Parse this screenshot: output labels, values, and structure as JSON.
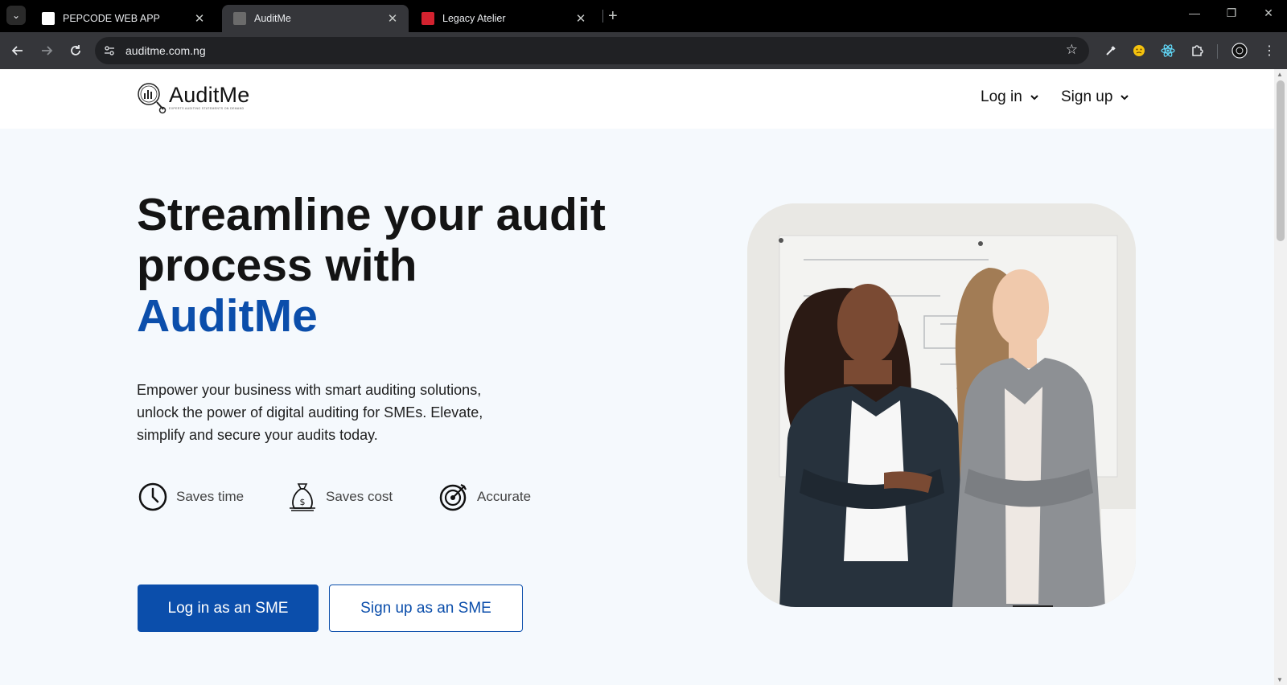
{
  "browser": {
    "tabs": [
      {
        "title": "PEPCODE WEB APP",
        "active": false,
        "favicon": "white-square"
      },
      {
        "title": "AuditMe",
        "active": true,
        "favicon": "auditme-gray"
      },
      {
        "title": "Legacy Atelier",
        "active": false,
        "favicon": "red-badge"
      }
    ],
    "url": "auditme.com.ng"
  },
  "site": {
    "logo": {
      "name": "AuditMe",
      "tagline": "EXPERTS AUDITING STATEMENTS ON DEMAND"
    },
    "nav": {
      "login_label": "Log in",
      "signup_label": "Sign up"
    },
    "hero": {
      "title_line1": "Streamline your audit",
      "title_line2": "process with",
      "title_accent": "AuditMe",
      "description": "Empower your business with smart auditing solutions, unlock the power of digital auditing for SMEs. Elevate, simplify and secure your audits today.",
      "features": [
        {
          "label": "Saves time",
          "icon": "clock-icon"
        },
        {
          "label": "Saves cost",
          "icon": "money-bag-icon"
        },
        {
          "label": "Accurate",
          "icon": "target-icon"
        }
      ],
      "primary_cta": "Log in as an SME",
      "secondary_cta": "Sign up as an SME"
    }
  },
  "colors": {
    "brand_blue": "#0b4eab",
    "hero_bg": "#f5f9fd",
    "browser_frame": "#35363a"
  }
}
